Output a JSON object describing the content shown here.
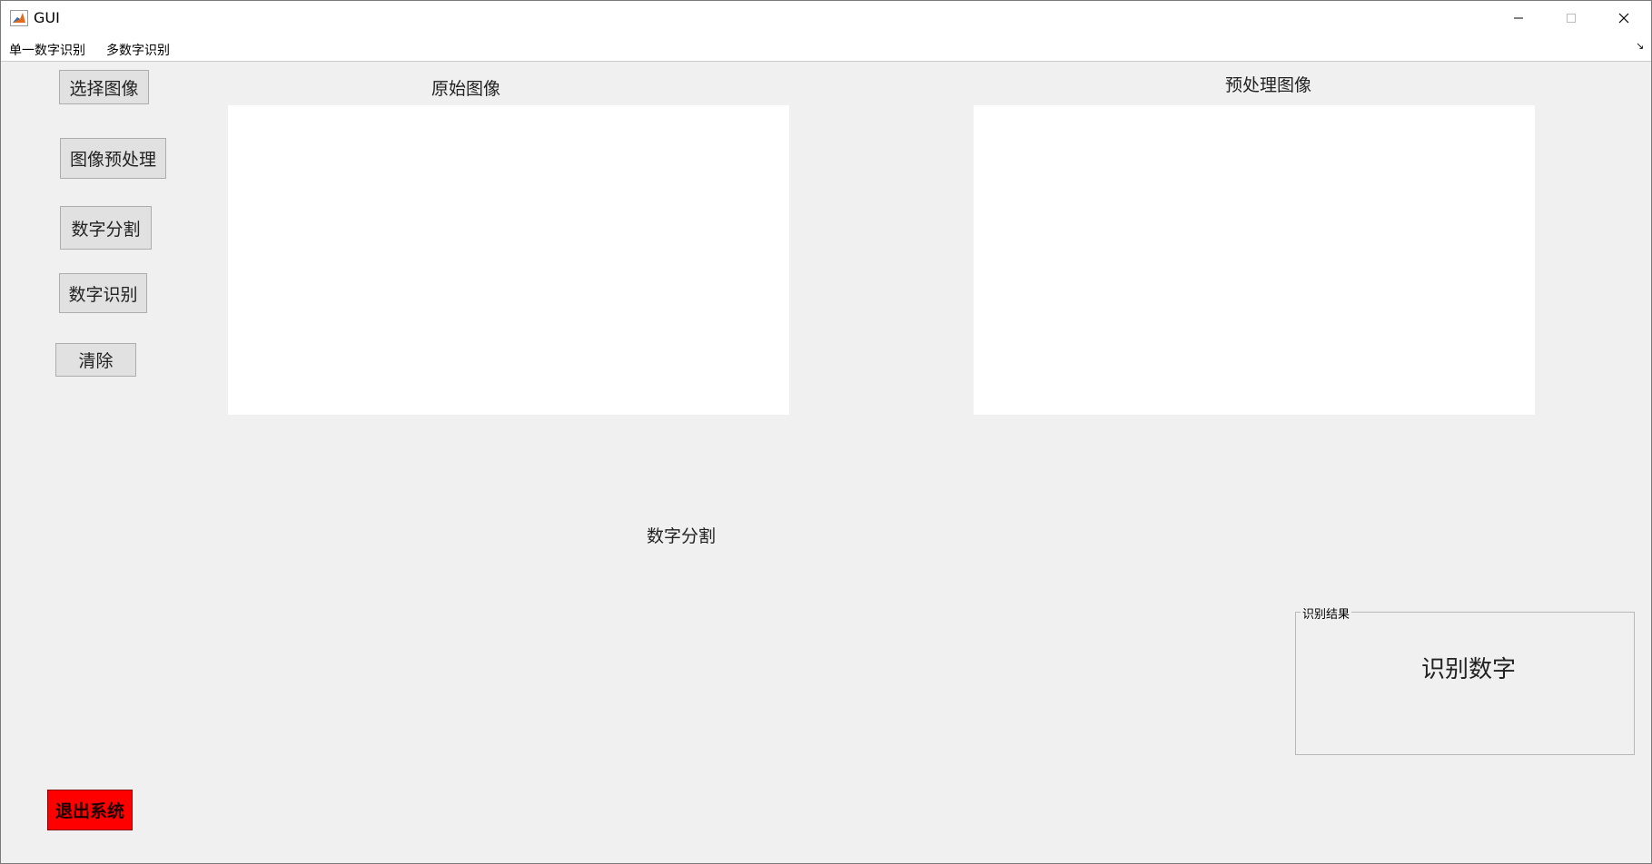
{
  "window": {
    "title": "GUI"
  },
  "menu": {
    "items": [
      {
        "label": "单一数字识别"
      },
      {
        "label": "多数字识别"
      }
    ]
  },
  "buttons": {
    "select_image": "选择图像",
    "preprocess": "图像预处理",
    "segment": "数字分割",
    "recognize": "数字识别",
    "clear": "清除",
    "exit": "退出系统"
  },
  "axes": {
    "original_title": "原始图像",
    "preprocessed_title": "预处理图像",
    "segment_title": "数字分割"
  },
  "result_panel": {
    "title": "识别结果",
    "value": "识别数字"
  },
  "colors": {
    "exit_button": "#ff0000",
    "background": "#f0f0f0"
  }
}
